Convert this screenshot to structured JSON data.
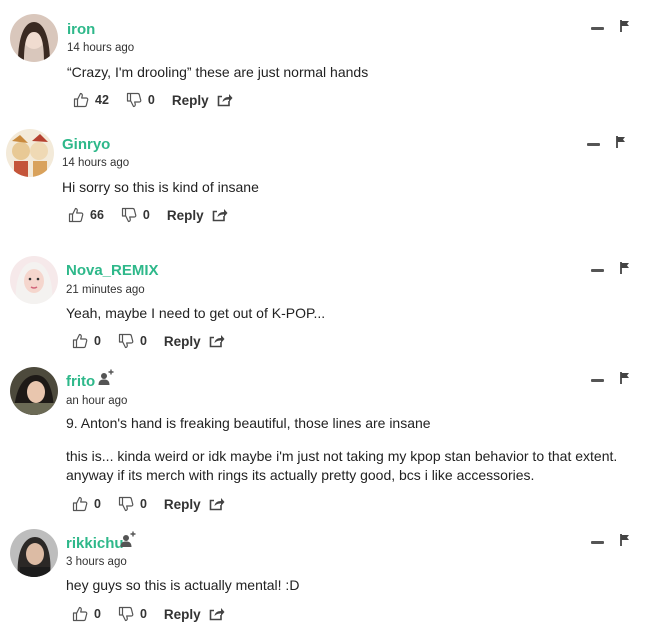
{
  "comments": [
    {
      "username": "iron",
      "time": "14 hours ago",
      "body": [
        "“Crazy, I'm drooling” these are just normal hands"
      ],
      "likes": "42",
      "dislikes": "0",
      "reply": "Reply",
      "avatar": "avatar-photo"
    },
    {
      "username": "Ginryo",
      "time": "14 hours ago",
      "body": [
        "Hi sorry so this is kind of insane"
      ],
      "likes": "66",
      "dislikes": "0",
      "reply": "Reply",
      "avatar": "avatar-anime-art"
    },
    {
      "username": "Nova_REMIX",
      "time": "21 minutes ago",
      "body": [
        "Yeah, maybe I need to get out of K-POP..."
      ],
      "likes": "0",
      "dislikes": "0",
      "reply": "Reply",
      "avatar": "avatar-photo"
    },
    {
      "username": "frito",
      "time": "an hour ago",
      "body": [
        "9. Anton's hand is freaking beautiful, those lines are insane",
        "this is... kinda weird or idk maybe i'm just not taking my kpop stan behavior to that extent.",
        "anyway if its merch with rings its actually pretty good, bcs i like accessories."
      ],
      "likes": "0",
      "dislikes": "0",
      "reply": "Reply",
      "avatar": "avatar-photo",
      "follow_icon": "user-plus-icon"
    },
    {
      "username": "rikkichu",
      "time": "3 hours ago",
      "body": [
        "hey guys so this is actually mental! :D"
      ],
      "likes": "0",
      "dislikes": "0",
      "reply": "Reply",
      "avatar": "avatar-photo",
      "follow_icon": "user-plus-icon"
    }
  ],
  "colors": {
    "username": "#2eb88a",
    "text": "#222222",
    "icon": "#555555"
  },
  "icons": [
    "thumbs-up-icon",
    "thumbs-down-icon",
    "share-icon",
    "collapse-icon",
    "flag-icon",
    "user-plus-icon"
  ]
}
